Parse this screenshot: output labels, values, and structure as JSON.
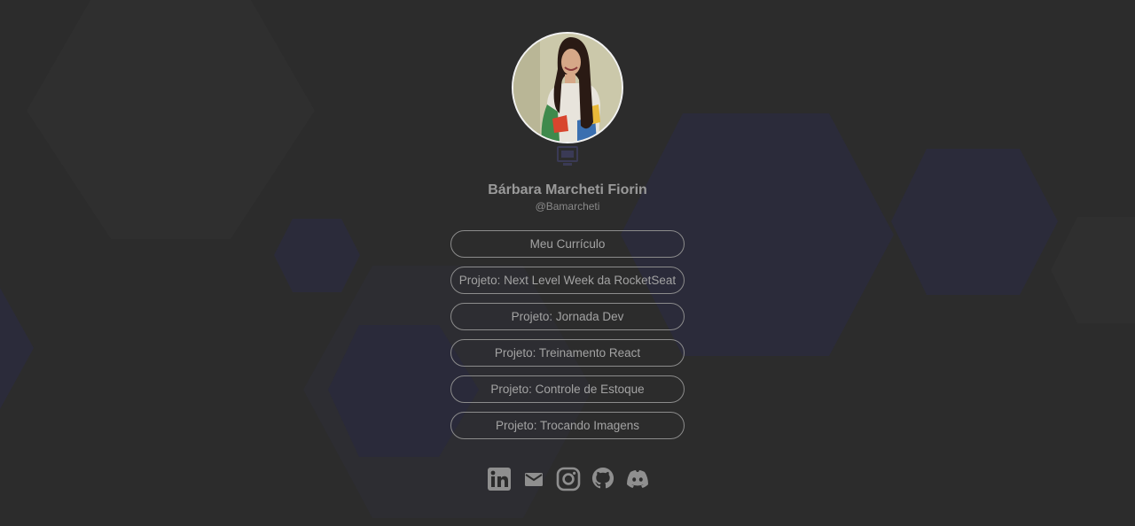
{
  "profile": {
    "name": "Bárbara Marcheti Fiorin",
    "handle": "@Bamarcheti"
  },
  "links": [
    {
      "label": "Meu Currículo"
    },
    {
      "label": "Projeto: Next Level Week da RocketSeat"
    },
    {
      "label": "Projeto: Jornada Dev"
    },
    {
      "label": "Projeto: Treinamento React"
    },
    {
      "label": "Projeto: Controle de Estoque"
    },
    {
      "label": "Projeto: Trocando Imagens"
    }
  ],
  "socials": [
    {
      "icon": "linkedin-icon"
    },
    {
      "icon": "email-icon"
    },
    {
      "icon": "instagram-icon"
    },
    {
      "icon": "github-icon"
    },
    {
      "icon": "discord-icon"
    }
  ],
  "colors": {
    "background": "#2c2c2c",
    "hexagon": "#2a2a3c",
    "text": "#a3a3a3",
    "border": "#8c8c8c"
  }
}
